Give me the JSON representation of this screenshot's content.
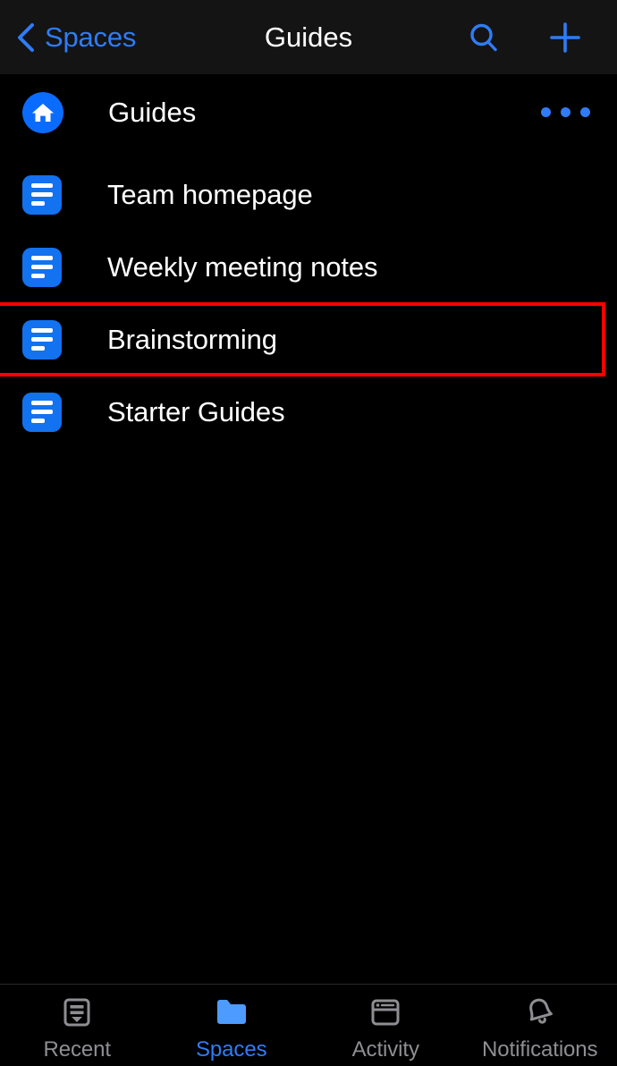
{
  "navbar": {
    "back_icon": "chevron-left-icon",
    "back_label": "Spaces",
    "title": "Guides",
    "search_icon": "search-icon",
    "add_icon": "plus-icon"
  },
  "space_header": {
    "icon": "home-icon",
    "label": "Guides",
    "more_icon": "more-horizontal-icon"
  },
  "pages": [
    {
      "icon": "page-icon",
      "label": "Team homepage",
      "highlighted": false
    },
    {
      "icon": "page-icon",
      "label": "Weekly meeting notes",
      "highlighted": false
    },
    {
      "icon": "page-icon",
      "label": "Brainstorming",
      "highlighted": true
    },
    {
      "icon": "page-icon",
      "label": "Starter Guides",
      "highlighted": false
    }
  ],
  "tabbar": {
    "tabs": [
      {
        "icon": "inbox-icon",
        "label": "Recent",
        "active": false
      },
      {
        "icon": "folder-icon",
        "label": "Spaces",
        "active": true
      },
      {
        "icon": "window-icon",
        "label": "Activity",
        "active": false
      },
      {
        "icon": "bell-icon",
        "label": "Notifications",
        "active": false
      }
    ]
  },
  "annotation": {
    "type": "highlight-rectangle",
    "color": "#ff0000",
    "target": "Brainstorming"
  },
  "colors": {
    "accent_blue": "#2f7cf6",
    "icon_blue": "#1272f0",
    "background": "#000000",
    "navbar_background": "#141414",
    "inactive_tab": "#8e8e93",
    "annotation_red": "#ff0000"
  }
}
